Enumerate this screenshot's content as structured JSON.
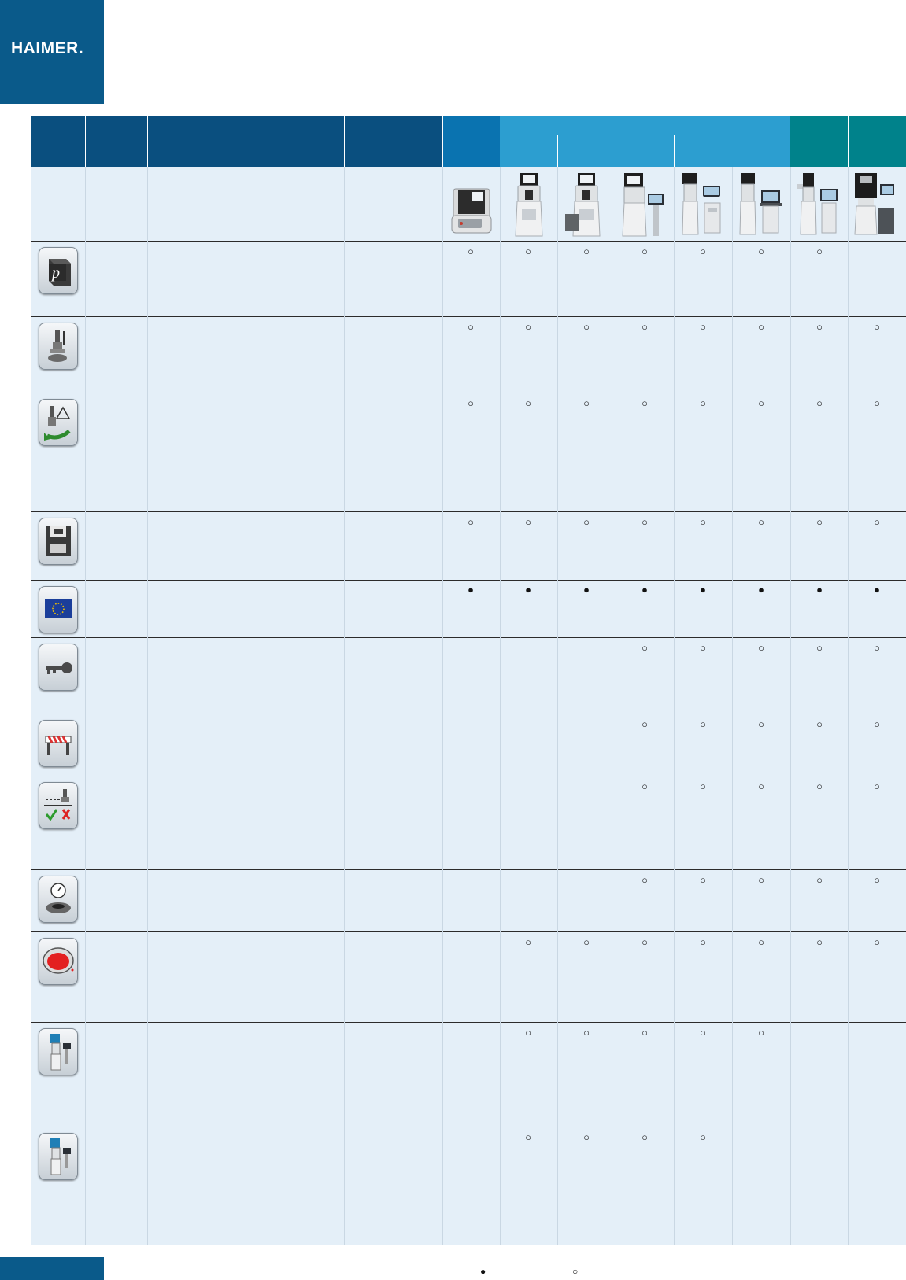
{
  "brand": {
    "logo_text": "HAIMER."
  },
  "colors": {
    "brand_blue": "#0a5a8a",
    "header_dark": "#0a4f7f",
    "header_mid": "#0a73b0",
    "header_light": "#2c9ed0",
    "header_teal": "#00828b",
    "row_bg": "#e4eff8"
  },
  "legend": {
    "standard_symbol": "●",
    "optional_symbol": "○"
  },
  "feature_icons": [
    "pi-cube-icon",
    "tool-holder-icon",
    "tool-measure-transfer-icon",
    "floppy-save-icon",
    "eu-flag-icon",
    "key-icon",
    "barrier-icon",
    "tool-check-ok-nok-icon",
    "dial-gauge-spindle-icon",
    "red-button-icon",
    "machine-tower-icon",
    "machine-tower-icon"
  ],
  "rows": [
    {
      "icon": "pi-cube-icon",
      "marks": [
        "○",
        "○",
        "○",
        "○",
        "○",
        "○",
        "○",
        ""
      ]
    },
    {
      "icon": "tool-holder-icon",
      "marks": [
        "○",
        "○",
        "○",
        "○",
        "○",
        "○",
        "○",
        "○"
      ]
    },
    {
      "icon": "tool-measure-transfer-icon",
      "marks": [
        "○",
        "○",
        "○",
        "○",
        "○",
        "○",
        "○",
        "○"
      ]
    },
    {
      "icon": "floppy-save-icon",
      "marks": [
        "○",
        "○",
        "○",
        "○",
        "○",
        "○",
        "○",
        "○"
      ]
    },
    {
      "icon": "eu-flag-icon",
      "marks": [
        "●",
        "●",
        "●",
        "●",
        "●",
        "●",
        "●",
        "●"
      ]
    },
    {
      "icon": "key-icon",
      "marks": [
        "",
        "",
        "",
        "○",
        "○",
        "○",
        "○",
        "○"
      ]
    },
    {
      "icon": "barrier-icon",
      "marks": [
        "",
        "",
        "",
        "○",
        "○",
        "○",
        "○",
        "○"
      ]
    },
    {
      "icon": "tool-check-ok-nok-icon",
      "marks": [
        "",
        "",
        "",
        "○",
        "○",
        "○",
        "○",
        "○"
      ]
    },
    {
      "icon": "dial-gauge-spindle-icon",
      "marks": [
        "",
        "",
        "",
        "○",
        "○",
        "○",
        "○",
        "○"
      ]
    },
    {
      "icon": "red-button-icon",
      "marks": [
        "",
        "○",
        "○",
        "○",
        "○",
        "○",
        "○",
        "○"
      ]
    },
    {
      "icon": "machine-tower-icon",
      "marks": [
        "",
        "○",
        "○",
        "○",
        "○",
        "○",
        "",
        ""
      ]
    },
    {
      "icon": "machine-tower-icon",
      "marks": [
        "",
        "○",
        "○",
        "○",
        "○",
        "",
        "",
        ""
      ]
    }
  ]
}
